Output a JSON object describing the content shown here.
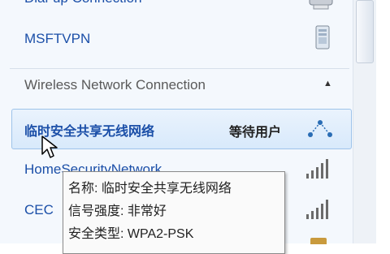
{
  "connections": {
    "dialup": {
      "label": "Dial-up Connection",
      "icon": "modem-icon"
    },
    "vpn": {
      "label": "MSFTVPN",
      "icon": "vpn-server-icon"
    }
  },
  "wireless": {
    "header": "Wireless Network Connection",
    "collapse_glyph": "▲",
    "networks": [
      {
        "name": "临时安全共享无线网络",
        "status": "等待用户",
        "icon": "adhoc-network-icon"
      },
      {
        "name": "HomeSecurityNetwork",
        "signal": 5
      },
      {
        "name": "CEC",
        "signal": 5
      }
    ]
  },
  "tooltip": {
    "name_line": "名称: 临时安全共享无线网络",
    "signal_line": "信号强度: 非常好",
    "security_line": "安全类型: WPA2-PSK"
  }
}
